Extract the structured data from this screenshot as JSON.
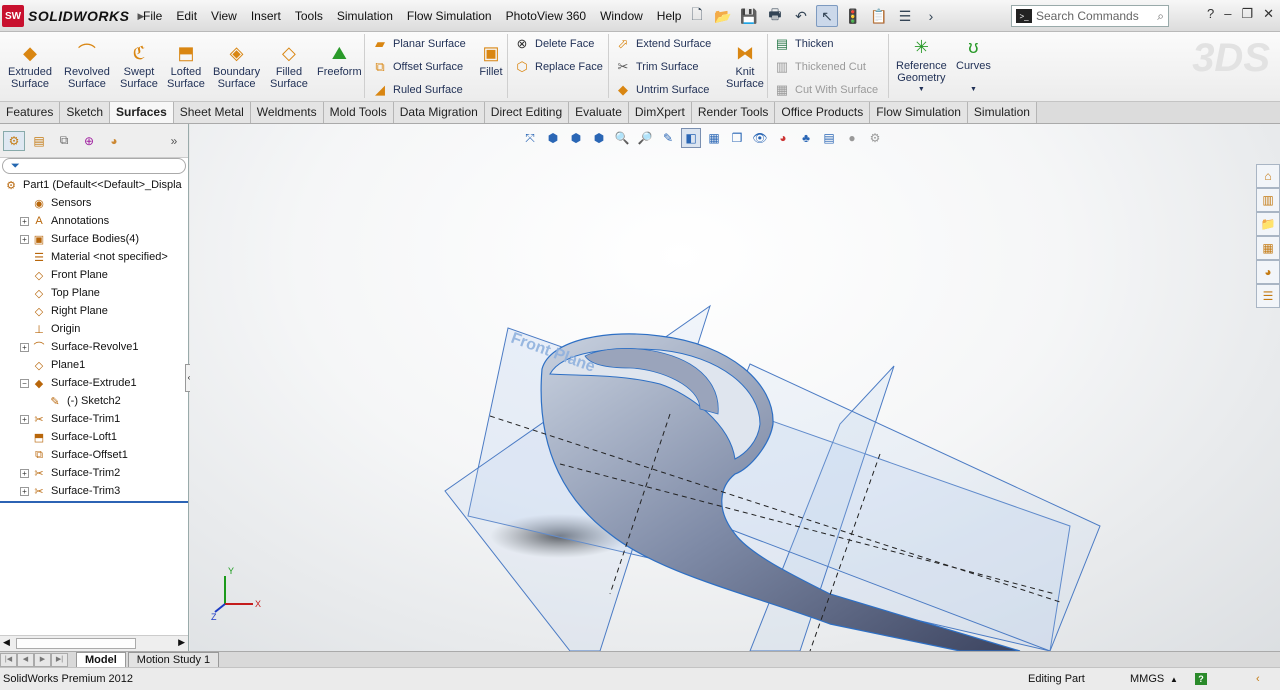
{
  "app": {
    "brand": "SOLIDWORKS",
    "brand_badge": "SW",
    "watermark": "3DS"
  },
  "menu": [
    "File",
    "Edit",
    "View",
    "Insert",
    "Tools",
    "Simulation",
    "Flow Simulation",
    "PhotoView 360",
    "Window",
    "Help"
  ],
  "search": {
    "placeholder": "Search Commands"
  },
  "ribbon": {
    "big": [
      {
        "id": "extruded",
        "label": "Extruded\nSurface"
      },
      {
        "id": "revolved",
        "label": "Revolved\nSurface"
      },
      {
        "id": "swept",
        "label": "Swept\nSurface"
      },
      {
        "id": "lofted",
        "label": "Lofted\nSurface"
      },
      {
        "id": "boundary",
        "label": "Boundary\nSurface"
      },
      {
        "id": "filled",
        "label": "Filled\nSurface"
      },
      {
        "id": "freeform",
        "label": "Freeform"
      },
      {
        "id": "fillet",
        "label": "Fillet"
      },
      {
        "id": "knit",
        "label": "Knit\nSurface"
      },
      {
        "id": "refgeom",
        "label": "Reference\nGeometry"
      },
      {
        "id": "curves",
        "label": "Curves"
      }
    ],
    "small": {
      "planar": "Planar Surface",
      "offset": "Offset Surface",
      "ruled": "Ruled Surface",
      "delete_face": "Delete Face",
      "replace_face": "Replace Face",
      "extend": "Extend Surface",
      "trim": "Trim Surface",
      "untrim": "Untrim Surface",
      "thicken": "Thicken",
      "thickened_cut": "Thickened Cut",
      "cut_with_surface": "Cut With Surface"
    }
  },
  "tabs": [
    {
      "label": "Features",
      "active": false
    },
    {
      "label": "Sketch",
      "active": false
    },
    {
      "label": "Surfaces",
      "active": true
    },
    {
      "label": "Sheet Metal",
      "active": false
    },
    {
      "label": "Weldments",
      "active": false
    },
    {
      "label": "Mold Tools",
      "active": false
    },
    {
      "label": "Data Migration",
      "active": false
    },
    {
      "label": "Direct Editing",
      "active": false
    },
    {
      "label": "Evaluate",
      "active": false
    },
    {
      "label": "DimXpert",
      "active": false
    },
    {
      "label": "Render Tools",
      "active": false
    },
    {
      "label": "Office Products",
      "active": false
    },
    {
      "label": "Flow Simulation",
      "active": false
    },
    {
      "label": "Simulation",
      "active": false
    }
  ],
  "tree": [
    {
      "label": "Part1  (Default<<Default>_Displa",
      "exp": "none",
      "indent": 0,
      "icon": "part-icon"
    },
    {
      "label": "Sensors",
      "exp": "none",
      "indent": 1,
      "icon": "sensor-icon"
    },
    {
      "label": "Annotations",
      "exp": "plus",
      "indent": 1,
      "icon": "annotation-icon"
    },
    {
      "label": "Surface Bodies(4)",
      "exp": "plus",
      "indent": 1,
      "icon": "surface-bodies-icon"
    },
    {
      "label": "Material <not specified>",
      "exp": "none",
      "indent": 1,
      "icon": "material-icon"
    },
    {
      "label": "Front Plane",
      "exp": "none",
      "indent": 1,
      "icon": "plane-icon"
    },
    {
      "label": "Top Plane",
      "exp": "none",
      "indent": 1,
      "icon": "plane-icon"
    },
    {
      "label": "Right Plane",
      "exp": "none",
      "indent": 1,
      "icon": "plane-icon"
    },
    {
      "label": "Origin",
      "exp": "none",
      "indent": 1,
      "icon": "origin-icon"
    },
    {
      "label": "Surface-Revolve1",
      "exp": "plus",
      "indent": 1,
      "icon": "revolve-icon"
    },
    {
      "label": "Plane1",
      "exp": "none",
      "indent": 1,
      "icon": "plane-icon"
    },
    {
      "label": "Surface-Extrude1",
      "exp": "minus",
      "indent": 1,
      "icon": "extrude-icon"
    },
    {
      "label": "(-) Sketch2",
      "exp": "none",
      "indent": 2,
      "icon": "sketch-icon"
    },
    {
      "label": "Surface-Trim1",
      "exp": "plus",
      "indent": 1,
      "icon": "trim-icon"
    },
    {
      "label": "Surface-Loft1",
      "exp": "none",
      "indent": 1,
      "icon": "loft-icon"
    },
    {
      "label": "Surface-Offset1",
      "exp": "none",
      "indent": 1,
      "icon": "offset-icon"
    },
    {
      "label": "Surface-Trim2",
      "exp": "plus",
      "indent": 1,
      "icon": "trim-icon"
    },
    {
      "label": "Surface-Trim3",
      "exp": "plus",
      "indent": 1,
      "icon": "trim-icon"
    }
  ],
  "viewport": {
    "plane_label": "Front Plane"
  },
  "bottom_tabs": [
    {
      "label": "Model",
      "active": true
    },
    {
      "label": "Motion Study 1",
      "active": false
    }
  ],
  "status": {
    "left": "SolidWorks Premium 2012",
    "mode": "Editing Part",
    "units": "MMGS",
    "help": "?"
  }
}
